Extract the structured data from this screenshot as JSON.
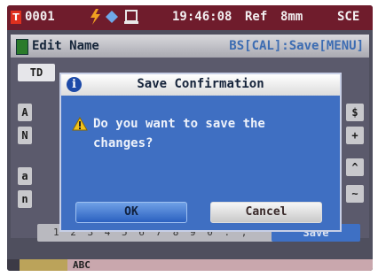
{
  "status_bar": {
    "channel": "0001",
    "clock": "19:46:08",
    "ref": "Ref",
    "aperture": "8mm",
    "mode": "SCE"
  },
  "window": {
    "title": "Edit Name",
    "hint": "BS[CAL]:Save[MENU]",
    "field_prefix": "TD",
    "keys_left": [
      "A",
      "N",
      "a",
      "n"
    ],
    "keys_right": [
      "$",
      "+",
      "^",
      "~"
    ],
    "number_row": "1 2 3 4 5 6 7 8 9 0 . ,",
    "save_label": "Save"
  },
  "dialog": {
    "title": "Save Confirmation",
    "message_line1": "Do you want to save the",
    "message_line2": "changes?",
    "ok_label": "OK",
    "cancel_label": "Cancel"
  },
  "bottom_bar": {
    "text": "ABC"
  },
  "colors": {
    "status_bar": "#6f1c2c",
    "dialog_bg": "#3f6fc2",
    "ok_button": "#2b61c0"
  }
}
